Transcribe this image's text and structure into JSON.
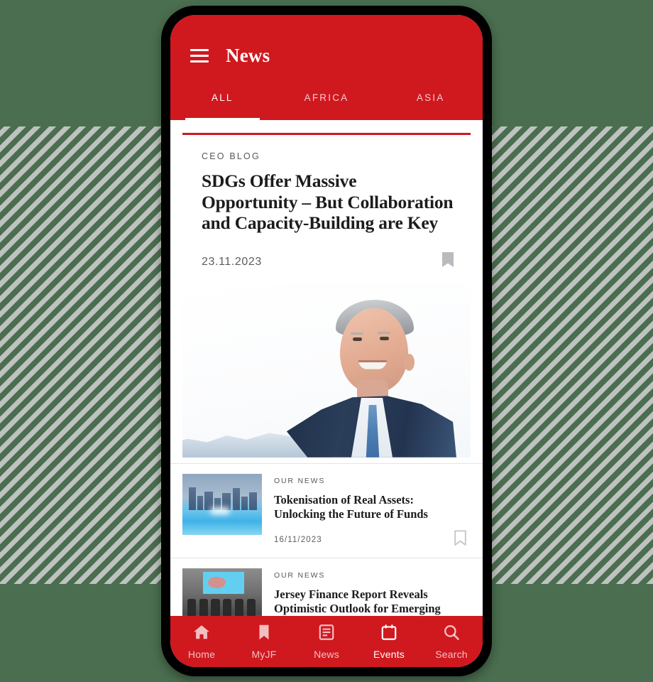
{
  "app": {
    "title": "News",
    "menu_icon": "hamburger-icon"
  },
  "tabs": [
    {
      "label": "ALL",
      "active": true
    },
    {
      "label": "AFRICA",
      "active": false
    },
    {
      "label": "ASIA",
      "active": false
    }
  ],
  "featured": {
    "kicker": "CEO BLOG",
    "title": "SDGs Offer Massive Opportunity – But Collaboration and Capacity-Building are Key",
    "date": "23.11.2023",
    "bookmark_icon": "bookmark-filled-icon",
    "image_alt": "portrait-photo"
  },
  "articles": [
    {
      "kicker": "OUR NEWS",
      "title": "Tokenisation of Real Assets: Unlocking the Future of Funds",
      "date": "16/11/2023",
      "bookmark_icon": "bookmark-outline-icon",
      "thumb": "city-skyline-thumbnail"
    },
    {
      "kicker": "OUR NEWS",
      "title": "Jersey Finance Report Reveals Optimistic Outlook for Emerging Saudi Arabian Family Business Leaders",
      "date": "",
      "bookmark_icon": "bookmark-outline-icon",
      "thumb": "event-panel-thumbnail"
    }
  ],
  "bottom_nav": [
    {
      "label": "Home",
      "icon": "home-icon",
      "active": false
    },
    {
      "label": "MyJF",
      "icon": "bookmark-icon",
      "active": false
    },
    {
      "label": "News",
      "icon": "article-icon",
      "active": false
    },
    {
      "label": "Events",
      "icon": "calendar-icon",
      "active": true
    },
    {
      "label": "Search",
      "icon": "search-icon",
      "active": false
    }
  ],
  "colors": {
    "brand_red": "#d0181f",
    "background_green": "#4a6e4f",
    "stripe_gray": "#bfc2bf"
  }
}
